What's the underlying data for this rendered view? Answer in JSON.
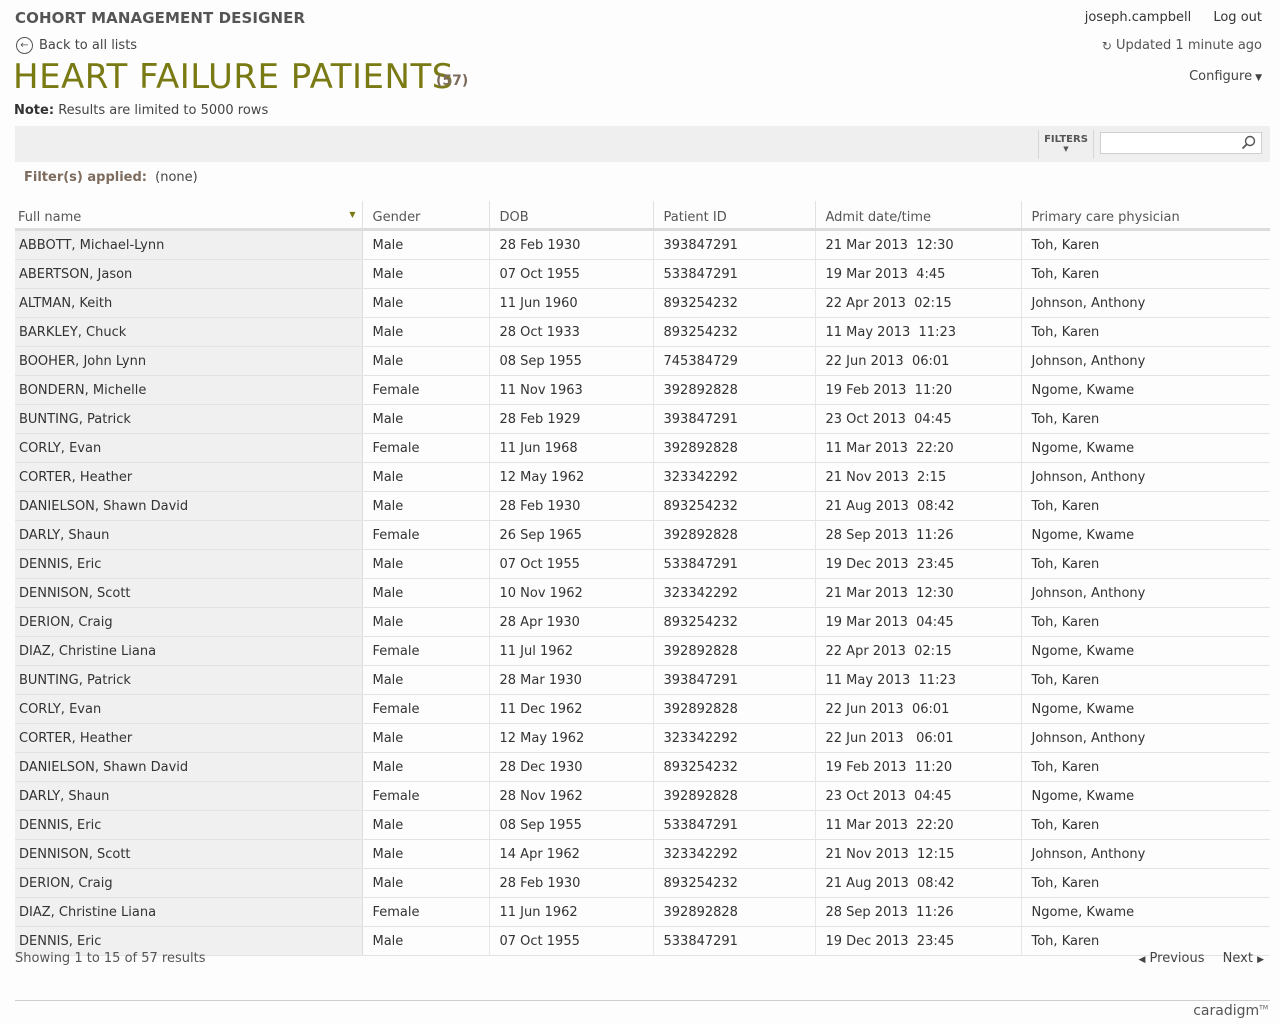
{
  "app": {
    "title": "COHORT MANAGEMENT DESIGNER",
    "user": "joseph.campbell",
    "logout": "Log out",
    "back": "Back to all lists",
    "updated": "Updated 1 minute ago",
    "configure": "Configure",
    "brand": "caradigm"
  },
  "page": {
    "title": "HEART FAILURE PATIENTS",
    "count": "(57)",
    "note_label": "Note:",
    "note_text": "Results are limited to 5000 rows",
    "filters_button": "FILTERS",
    "search_placeholder": "",
    "filters_applied_label": "Filter(s) applied:",
    "filters_applied_value": "(none)"
  },
  "table": {
    "columns": [
      "Full name",
      "Gender",
      "DOB",
      "Patient ID",
      "Admit date/time",
      "Primary care physician"
    ],
    "rows": [
      [
        "ABBOTT, Michael-Lynn",
        "Male",
        "28 Feb 1930",
        "393847291",
        "21 Mar 2013  12:30",
        "Toh, Karen"
      ],
      [
        "ABERTSON, Jason",
        "Male",
        "07 Oct 1955",
        "533847291",
        "19 Mar 2013  4:45",
        "Toh, Karen"
      ],
      [
        "ALTMAN, Keith",
        "Male",
        "11 Jun 1960",
        "893254232",
        "22 Apr 2013  02:15",
        "Johnson, Anthony"
      ],
      [
        "BARKLEY, Chuck",
        "Male",
        "28 Oct 1933",
        "893254232",
        "11 May 2013  11:23",
        "Toh, Karen"
      ],
      [
        "BOOHER, John Lynn",
        "Male",
        "08 Sep 1955",
        "745384729",
        "22 Jun 2013  06:01",
        "Johnson, Anthony"
      ],
      [
        "BONDERN, Michelle",
        "Female",
        "11 Nov 1963",
        "392892828",
        "19 Feb 2013  11:20",
        "Ngome, Kwame"
      ],
      [
        "BUNTING, Patrick",
        "Male",
        "28 Feb 1929",
        "393847291",
        "23 Oct 2013  04:45",
        "Toh, Karen"
      ],
      [
        "CORLY, Evan",
        "Female",
        "11 Jun 1968",
        "392892828",
        "11 Mar 2013  22:20",
        "Ngome, Kwame"
      ],
      [
        "CORTER, Heather",
        "Male",
        "12 May 1962",
        "323342292",
        "21 Nov 2013  2:15",
        "Johnson, Anthony"
      ],
      [
        "DANIELSON, Shawn David",
        "Male",
        "28 Feb 1930",
        "893254232",
        "21 Aug 2013  08:42",
        "Toh, Karen"
      ],
      [
        "DARLY, Shaun",
        "Female",
        "26 Sep 1965",
        "392892828",
        "28 Sep 2013  11:26",
        "Ngome, Kwame"
      ],
      [
        "DENNIS, Eric",
        "Male",
        "07 Oct 1955",
        "533847291",
        "19 Dec 2013  23:45",
        "Toh, Karen"
      ],
      [
        "DENNISON, Scott",
        "Male",
        "10 Nov 1962",
        "323342292",
        "21 Mar 2013  12:30",
        "Johnson, Anthony"
      ],
      [
        "DERION, Craig",
        "Male",
        "28 Apr 1930",
        "893254232",
        "19 Mar 2013  04:45",
        "Toh, Karen"
      ],
      [
        "DIAZ, Christine Liana",
        "Female",
        "11 Jul 1962",
        "392892828",
        "22 Apr 2013  02:15",
        "Ngome, Kwame"
      ],
      [
        "BUNTING, Patrick",
        "Male",
        "28 Mar 1930",
        "393847291",
        "11 May 2013  11:23",
        "Toh, Karen"
      ],
      [
        "CORLY, Evan",
        "Female",
        "11 Dec 1962",
        "392892828",
        "22 Jun 2013  06:01",
        "Ngome, Kwame"
      ],
      [
        "CORTER, Heather",
        "Male",
        "12 May 1962",
        "323342292",
        "22 Jun 2013   06:01",
        "Johnson, Anthony"
      ],
      [
        "DANIELSON, Shawn David",
        "Male",
        "28 Dec 1930",
        "893254232",
        "19 Feb 2013  11:20",
        "Toh, Karen"
      ],
      [
        "DARLY, Shaun",
        "Female",
        "28 Nov 1962",
        "392892828",
        "23 Oct 2013  04:45",
        "Ngome, Kwame"
      ],
      [
        "DENNIS, Eric",
        "Male",
        "08 Sep 1955",
        "533847291",
        "11 Mar 2013  22:20",
        "Toh, Karen"
      ],
      [
        "DENNISON, Scott",
        "Male",
        "14 Apr 1962",
        "323342292",
        "21 Nov 2013  12:15",
        "Johnson, Anthony"
      ],
      [
        "DERION, Craig",
        "Male",
        "28 Feb 1930",
        "893254232",
        "21 Aug 2013  08:42",
        "Toh, Karen"
      ],
      [
        "DIAZ, Christine Liana",
        "Female",
        "11 Jun 1962",
        "392892828",
        "28 Sep 2013  11:26",
        "Ngome, Kwame"
      ],
      [
        "DENNIS, Eric",
        "Male",
        "07 Oct 1955",
        "533847291",
        "19 Dec 2013  23:45",
        "Toh, Karen"
      ]
    ]
  },
  "pagination": {
    "showing": "Showing 1 to 15 of 57 results",
    "previous": "Previous",
    "next": "Next"
  },
  "colors": {
    "title": "#7a7a14",
    "accent_label": "#7d6c5e",
    "toolbar_bg": "#efefef"
  },
  "icons": {
    "back": "circle-arrow-left-icon",
    "refresh": "refresh-icon",
    "search": "magnifier-icon",
    "sort": "sort-desc-icon"
  }
}
